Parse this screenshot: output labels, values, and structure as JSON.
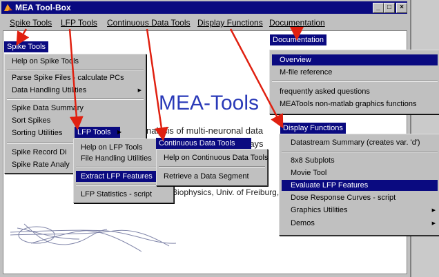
{
  "window": {
    "title": "MEA Tool-Box",
    "min": "_",
    "max": "□",
    "close": "×"
  },
  "menubar": {
    "items": [
      {
        "label": "Spike Tools"
      },
      {
        "label": "LFP Tools"
      },
      {
        "label": "Continuous Data Tools"
      },
      {
        "label": "Display Functions"
      },
      {
        "label": "Documentation"
      }
    ]
  },
  "canvas": {
    "title": "MEA-Tools",
    "line1": "nalysis of multi-neuronal data",
    "line2": "rays",
    "line3": "Biophysics, Univ. of Freiburg,"
  },
  "spike_strip": "Spike Tools",
  "doc_strip": "Documentation",
  "spike_menu": [
    "Help on Spike Tools",
    "Parse Spike Files - calculate PCs",
    "Data Handling Utilities",
    "Spike Data Summary",
    "Sort Spikes",
    "Sorting Utilities",
    "Spike Record Di",
    "Spike Rate Analy"
  ],
  "lfp_strip": "LFP Tools",
  "lfp_menu": [
    "Help on LFP Tools",
    "File Handling Utilities",
    "Extract LFP Features",
    "LFP Statistics - script"
  ],
  "cont_strip": "Continuous Data Tools",
  "cont_menu": [
    "Help on Continuous Data Tools",
    "Retrieve a Data Segment"
  ],
  "doc_menu": [
    "Overview",
    "M-file reference",
    "frequently asked questions",
    "MEATools non-matlab graphics functions"
  ],
  "disp_strip": "Display Functions",
  "disp_menu": [
    "Datastream Summary (creates var. 'd')",
    "8x8 Subplots",
    "Movie Tool",
    "Evaluate LFP Features",
    "Dose Response Curves - script",
    "Graphics Utilities",
    "Demos"
  ],
  "colors": {
    "title_bar": "#0a0a80",
    "highlight": "#0a0a80",
    "arrow": "#e02010",
    "heading": "#2a3ab8"
  }
}
